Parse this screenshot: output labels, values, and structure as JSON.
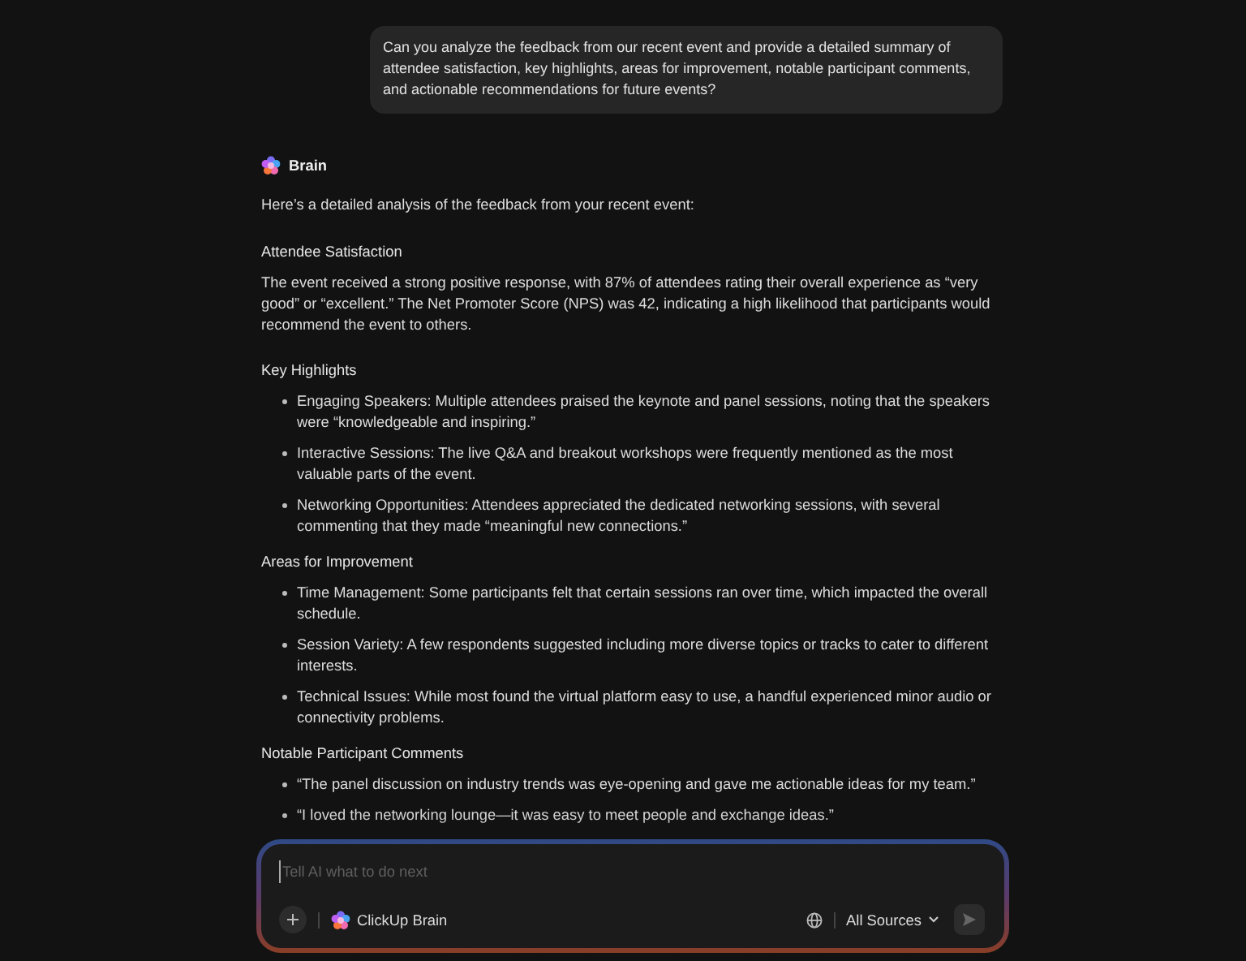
{
  "user_message": "Can you analyze the feedback from our recent event and provide a detailed summary of attendee satisfaction, key highlights, areas for improvement, notable participant comments, and actionable recommendations for future events?",
  "assistant": {
    "name": "Brain",
    "intro": "Here’s a detailed analysis of the feedback from your recent event:",
    "sections": [
      {
        "heading": "Attendee Satisfaction",
        "kind": "paragraph",
        "text": "The event received a strong positive response, with 87% of attendees rating their overall experience as “very good” or “excellent.” The Net Promoter Score (NPS) was 42, indicating a high likelihood that participants would recommend the event to others."
      },
      {
        "heading": "Key Highlights",
        "kind": "list",
        "items": [
          "Engaging Speakers: Multiple attendees praised the keynote and panel sessions, noting that the speakers were “knowledgeable and inspiring.”",
          "Interactive Sessions: The live Q&A and breakout workshops were frequently mentioned as the most valuable parts of the event.",
          "Networking Opportunities: Attendees appreciated the dedicated networking sessions, with several commenting that they made “meaningful new connections.”"
        ]
      },
      {
        "heading": "Areas for Improvement",
        "kind": "list",
        "items": [
          "Time Management: Some participants felt that certain sessions ran over time, which impacted the overall schedule.",
          "Session Variety: A few respondents suggested including more diverse topics or tracks to cater to different interests.",
          "Technical Issues: While most found the virtual platform easy to use, a handful experienced minor audio or connectivity problems."
        ]
      },
      {
        "heading": "Notable Participant Comments",
        "kind": "list",
        "items": [
          "“The panel discussion on industry trends was eye-opening and gave me actionable ideas for my team.”",
          "“I loved the networking lounge—it was easy to meet people and exchange ideas.”"
        ]
      }
    ]
  },
  "composer": {
    "placeholder": "Tell AI what to do next",
    "agent": "ClickUp Brain",
    "sources": "All Sources"
  }
}
